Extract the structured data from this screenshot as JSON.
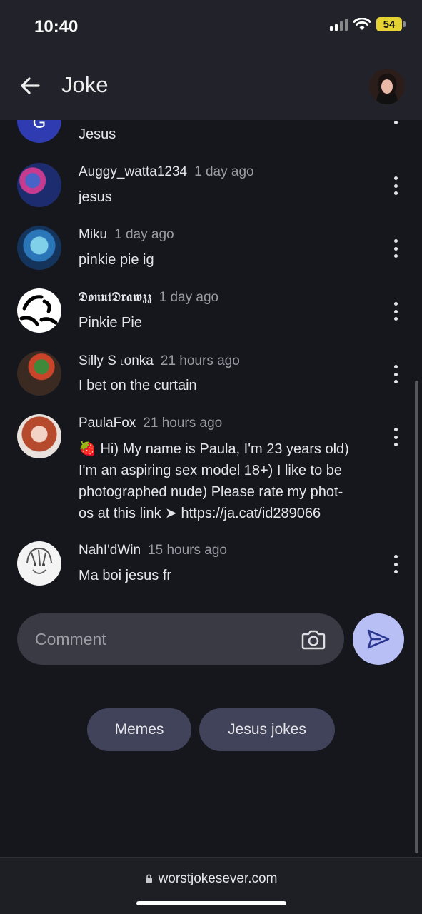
{
  "status": {
    "time": "10:40",
    "battery": "54"
  },
  "header": {
    "title": "Joke"
  },
  "comments": [
    {
      "author": "",
      "time": "",
      "text": "Jesus",
      "avatar_letter": "G"
    },
    {
      "author": "Auggy_watta1234",
      "time": "1 day ago",
      "text": "jesus"
    },
    {
      "author": "Miku",
      "time": "1 day ago",
      "text": "pinkie pie ig"
    },
    {
      "author": "𝕯𝖔𝖓𝖚𝖙𝕯𝖗𝖆𝖜𝖟𝖟",
      "time": "1 day ago",
      "text": "Pinkie Pie"
    },
    {
      "author": "Silly S ₜonka",
      "time": "21 hours ago",
      "text": "I bet on the curtain"
    },
    {
      "author": "PaulaFox",
      "time": "21 hours ago",
      "text_lines": [
        "🍓 Hi) My name is Paula, I'm 23 years old)",
        "I'm an aspiring sex model 18+) I like to be",
        "photographed nude) Please rate my phot-",
        "os at this link ➤ https://ja.cat/id289066"
      ]
    },
    {
      "author": "NahI'dWin",
      "time": "15 hours ago",
      "text": "Ma boi jesus fr"
    }
  ],
  "comment_input": {
    "placeholder": "Comment",
    "value": ""
  },
  "tags": [
    "Memes",
    "Jesus jokes"
  ],
  "browser": {
    "url": "worstjokesever.com"
  },
  "colors": {
    "background": "#16171d",
    "header": "#22232a",
    "send_button": "#b7bff5",
    "tag": "#41435a",
    "input": "#393a43"
  }
}
